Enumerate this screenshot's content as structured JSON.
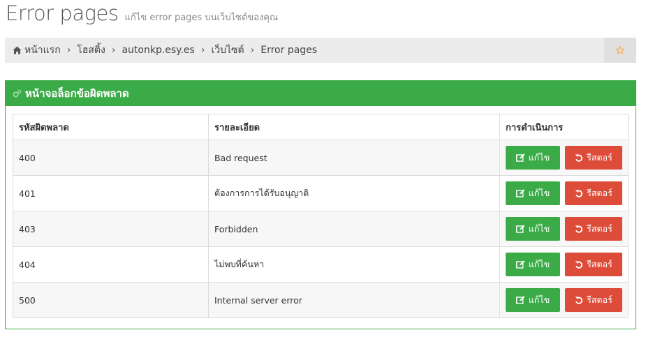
{
  "header": {
    "title": "Error pages",
    "subtitle": "แก้ไข error pages บนเว็บไซต์ของคุณ"
  },
  "breadcrumb": {
    "items": [
      "หน้าแรก",
      "โฮสติ้ง",
      "autonkp.esy.es",
      "เว็บไซต์",
      "Error pages"
    ],
    "separator": "›"
  },
  "panel": {
    "title": "หน้าจอล็อกข้อผิดพลาด",
    "accent_color": "#3aab47"
  },
  "table": {
    "columns": [
      "รหัสผิดพลาด",
      "รายละเอียด",
      "การดำเนินการ"
    ],
    "rows": [
      {
        "code": "400",
        "description": "Bad request"
      },
      {
        "code": "401",
        "description": "ต้องการการได้รับอนุญาติ"
      },
      {
        "code": "403",
        "description": "Forbidden"
      },
      {
        "code": "404",
        "description": "ไม่พบที่ค้นหา"
      },
      {
        "code": "500",
        "description": "Internal server error"
      }
    ],
    "edit_label": "แก้ไข",
    "restore_label": "รีสตอร์",
    "edit_color": "#3aab47",
    "restore_color": "#dd4b39"
  },
  "icons": {
    "home": "home-icon",
    "star": "star-icon",
    "panel": "cogs-icon",
    "edit": "edit-icon",
    "restore": "undo-icon"
  }
}
